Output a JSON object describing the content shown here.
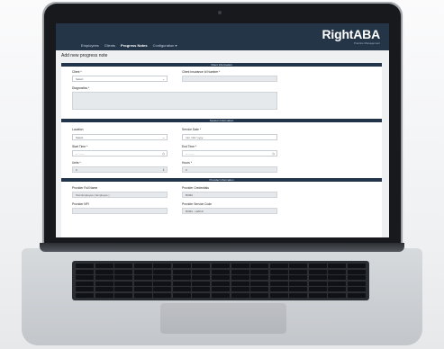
{
  "app": {
    "brand": "RightABA",
    "brand_sub": "Practice Management"
  },
  "nav": {
    "items": [
      "Employees",
      "Clients",
      "Progress Notes",
      "Configuration ▾"
    ],
    "active_index": 2
  },
  "page": {
    "title": "Add new progress note"
  },
  "sections": {
    "client_info": {
      "title": "Client Information",
      "client_label": "Client *",
      "client_value": "Select",
      "insurance_label": "Client Insurance Id Number *",
      "insurance_value": "",
      "diagnostics_label": "Diagnostics *",
      "diagnostics_value": ""
    },
    "session_info": {
      "title": "Session Information",
      "location_label": "Location",
      "location_value": "Select",
      "service_date_label": "Service Date *",
      "service_date_value": "mm / dd / yyyy",
      "start_time_label": "Start Time *",
      "start_time_value": "-- : -- --",
      "end_time_label": "End Time *",
      "end_time_value": "-- : -- --",
      "units_label": "Units *",
      "units_value": "0",
      "hours_label": "Hours *",
      "hours_value": "0"
    },
    "provider_info": {
      "title": "Provider Information",
      "full_name_label": "Provider Full Name",
      "full_name_value": "Test Employee ( Employee )",
      "credentials_label": "Provider Credentials",
      "credentials_value": "BCBA",
      "npi_label": "Provider NPI",
      "npi_value": "",
      "service_code_label": "Provider Service Code",
      "service_code_value": "BCBA - H2019"
    }
  },
  "icons": {
    "dropdown": "chevron-down-icon",
    "time": "clock-icon"
  },
  "colors": {
    "nav_bg": "#243548",
    "section_bar": "#213449",
    "laptop_bezel": "#17191c"
  }
}
